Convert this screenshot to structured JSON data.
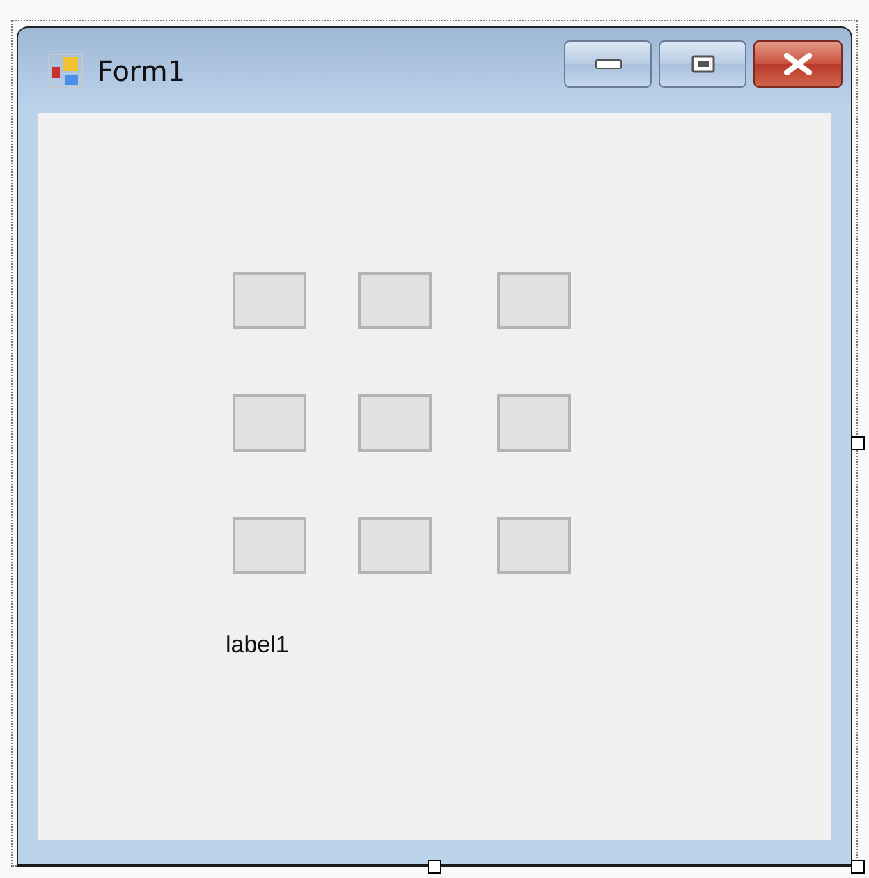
{
  "window": {
    "title": "Form1"
  },
  "buttons": [
    {
      "kind": "button"
    },
    {
      "kind": "button"
    },
    {
      "kind": "button"
    },
    {
      "kind": "button"
    },
    {
      "kind": "button"
    },
    {
      "kind": "button"
    },
    {
      "kind": "button"
    },
    {
      "kind": "button"
    },
    {
      "kind": "button"
    }
  ],
  "label": "label1"
}
